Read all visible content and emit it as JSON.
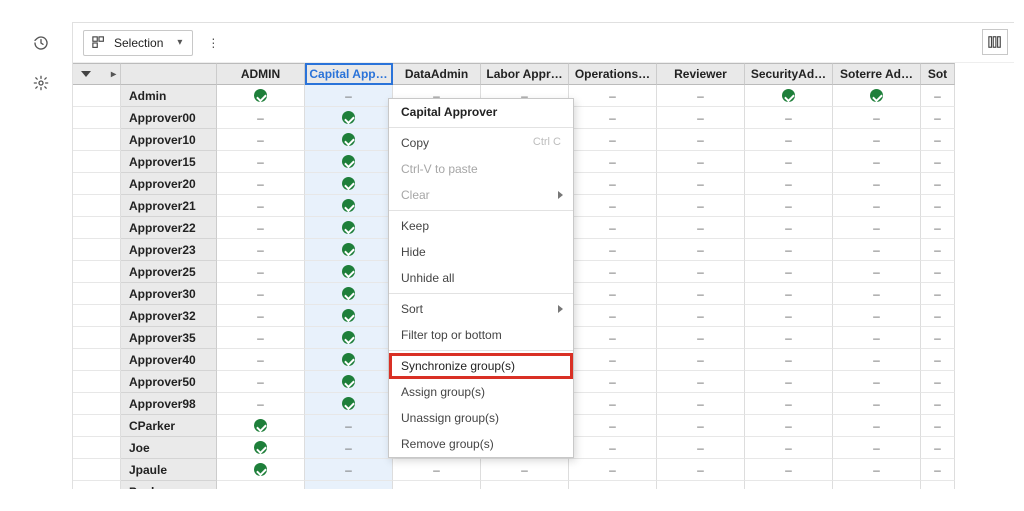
{
  "toolbar": {
    "selection_label": "Selection"
  },
  "columns": [
    "ADMIN",
    "Capital App…",
    "DataAdmin",
    "Labor Appr…",
    "Operations…",
    "Reviewer",
    "SecurityAd…",
    "Soterre Ad…",
    "Sot"
  ],
  "active_column_index": 1,
  "rows": [
    {
      "name": "Admin",
      "cells": [
        "check",
        "dash",
        "dash",
        "dash",
        "dash",
        "dash",
        "check",
        "check",
        "dash"
      ]
    },
    {
      "name": "Approver00",
      "cells": [
        "dash",
        "check",
        "dash",
        "dash",
        "dash",
        "dash",
        "dash",
        "dash",
        "dash"
      ]
    },
    {
      "name": "Approver10",
      "cells": [
        "dash",
        "check",
        "dash",
        "dash",
        "dash",
        "dash",
        "dash",
        "dash",
        "dash"
      ]
    },
    {
      "name": "Approver15",
      "cells": [
        "dash",
        "check",
        "dash",
        "dash",
        "dash",
        "dash",
        "dash",
        "dash",
        "dash"
      ]
    },
    {
      "name": "Approver20",
      "cells": [
        "dash",
        "check",
        "dash",
        "dash",
        "dash",
        "dash",
        "dash",
        "dash",
        "dash"
      ]
    },
    {
      "name": "Approver21",
      "cells": [
        "dash",
        "check",
        "dash",
        "dash",
        "dash",
        "dash",
        "dash",
        "dash",
        "dash"
      ]
    },
    {
      "name": "Approver22",
      "cells": [
        "dash",
        "check",
        "dash",
        "dash",
        "dash",
        "dash",
        "dash",
        "dash",
        "dash"
      ]
    },
    {
      "name": "Approver23",
      "cells": [
        "dash",
        "check",
        "dash",
        "dash",
        "dash",
        "dash",
        "dash",
        "dash",
        "dash"
      ]
    },
    {
      "name": "Approver25",
      "cells": [
        "dash",
        "check",
        "dash",
        "dash",
        "dash",
        "dash",
        "dash",
        "dash",
        "dash"
      ]
    },
    {
      "name": "Approver30",
      "cells": [
        "dash",
        "check",
        "dash",
        "dash",
        "dash",
        "dash",
        "dash",
        "dash",
        "dash"
      ]
    },
    {
      "name": "Approver32",
      "cells": [
        "dash",
        "check",
        "dash",
        "dash",
        "dash",
        "dash",
        "dash",
        "dash",
        "dash"
      ]
    },
    {
      "name": "Approver35",
      "cells": [
        "dash",
        "check",
        "dash",
        "dash",
        "dash",
        "dash",
        "dash",
        "dash",
        "dash"
      ]
    },
    {
      "name": "Approver40",
      "cells": [
        "dash",
        "check",
        "dash",
        "dash",
        "dash",
        "dash",
        "dash",
        "dash",
        "dash"
      ]
    },
    {
      "name": "Approver50",
      "cells": [
        "dash",
        "check",
        "dash",
        "dash",
        "dash",
        "dash",
        "dash",
        "dash",
        "dash"
      ]
    },
    {
      "name": "Approver98",
      "cells": [
        "dash",
        "check",
        "dash",
        "dash",
        "dash",
        "dash",
        "dash",
        "dash",
        "dash"
      ]
    },
    {
      "name": "CParker",
      "cells": [
        "check",
        "dash",
        "dash",
        "dash",
        "dash",
        "dash",
        "dash",
        "dash",
        "dash"
      ]
    },
    {
      "name": "Joe",
      "cells": [
        "check",
        "dash",
        "dash",
        "dash",
        "dash",
        "dash",
        "dash",
        "dash",
        "dash"
      ]
    },
    {
      "name": "Jpaule",
      "cells": [
        "check",
        "dash",
        "dash",
        "dash",
        "dash",
        "dash",
        "dash",
        "dash",
        "dash"
      ]
    },
    {
      "name": "Paul",
      "cells": [
        "",
        "",
        "",
        "",
        "",
        "",
        "",
        "",
        ""
      ]
    }
  ],
  "context_menu": {
    "title": "Capital Approver",
    "items": [
      {
        "label": "Copy",
        "hint": "Ctrl C",
        "type": "item"
      },
      {
        "label": "Ctrl-V to paste",
        "type": "disabled"
      },
      {
        "label": "Clear",
        "type": "submenu-disabled"
      },
      {
        "type": "sep"
      },
      {
        "label": "Keep",
        "type": "item"
      },
      {
        "label": "Hide",
        "type": "item"
      },
      {
        "label": "Unhide all",
        "type": "item"
      },
      {
        "type": "sep"
      },
      {
        "label": "Sort",
        "type": "submenu"
      },
      {
        "label": "Filter top or bottom",
        "type": "item"
      },
      {
        "type": "sep"
      },
      {
        "label": "Synchronize group(s)",
        "type": "highlighted"
      },
      {
        "label": "Assign group(s)",
        "type": "item"
      },
      {
        "label": "Unassign group(s)",
        "type": "item"
      },
      {
        "label": "Remove group(s)",
        "type": "item"
      }
    ]
  }
}
